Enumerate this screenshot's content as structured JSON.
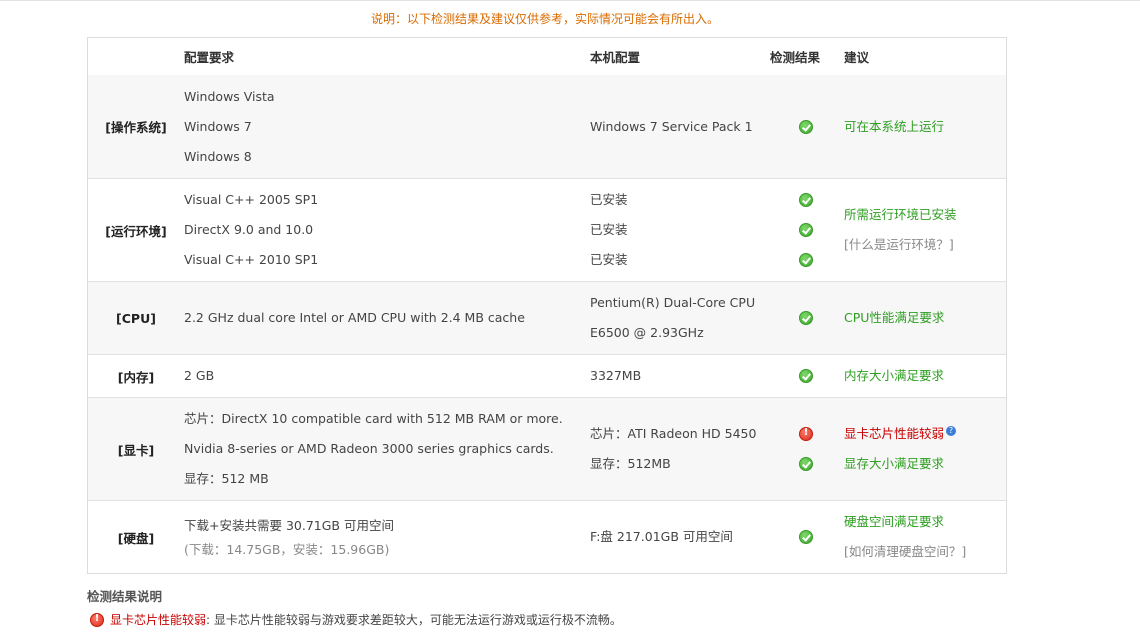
{
  "notice": "说明：以下检测结果及建议仅供参考，实际情况可能会有所出入。",
  "headers": {
    "requirement": "配置要求",
    "local": "本机配置",
    "result": "检测结果",
    "advice": "建议"
  },
  "rows": [
    {
      "label": "[操作系统]",
      "requirements": [
        "Windows Vista",
        "Windows 7",
        "Windows 8"
      ],
      "local": [
        "Windows 7 Service Pack 1"
      ],
      "results": [
        "ok"
      ],
      "advice": [
        {
          "text": "可在本系统上运行",
          "style": "green"
        }
      ]
    },
    {
      "label": "[运行环境]",
      "requirements": [
        "Visual C++ 2005 SP1",
        "DirectX 9.0 and 10.0",
        "Visual C++ 2010 SP1"
      ],
      "local": [
        "已安装",
        "已安装",
        "已安装"
      ],
      "results": [
        "ok",
        "ok",
        "ok"
      ],
      "advice": [
        {
          "text": "所需运行环境已安装",
          "style": "green"
        },
        {
          "text": "[什么是运行环境？]",
          "style": "gray"
        }
      ]
    },
    {
      "label": "[CPU]",
      "requirements": [
        "2.2 GHz dual core Intel or AMD CPU with 2.4 MB cache"
      ],
      "local": [
        "Pentium(R) Dual-Core CPU",
        "E6500 @ 2.93GHz"
      ],
      "results": [
        "ok"
      ],
      "advice": [
        {
          "text": "CPU性能满足要求",
          "style": "green"
        }
      ]
    },
    {
      "label": "[内存]",
      "requirements": [
        "2 GB"
      ],
      "local": [
        "3327MB"
      ],
      "results": [
        "ok"
      ],
      "advice": [
        {
          "text": "内存大小满足要求",
          "style": "green"
        }
      ]
    },
    {
      "label": "[显卡]",
      "requirements": [
        "芯片：DirectX 10 compatible card with 512 MB RAM or more.",
        "Nvidia 8-series or AMD Radeon 3000 series graphics cards.",
        "显存：512 MB"
      ],
      "local": [
        "芯片：ATI Radeon HD 5450",
        "显存：512MB"
      ],
      "results": [
        "bad",
        "ok"
      ],
      "advice": [
        {
          "text": "显卡芯片性能较弱",
          "style": "red",
          "help": "?"
        },
        {
          "text": "显存大小满足要求",
          "style": "green"
        }
      ]
    },
    {
      "label": "[硬盘]",
      "requirements": [
        "下载+安装共需要  30.71GB 可用空间"
      ],
      "requirements_sub": "(下载：14.75GB，安装：15.96GB)",
      "local": [
        "F:盘  217.01GB 可用空间"
      ],
      "results": [
        "ok"
      ],
      "advice": [
        {
          "text": "硬盘空间满足要求",
          "style": "green"
        },
        {
          "text": "[如何清理硬盘空间？]",
          "style": "gray"
        }
      ]
    }
  ],
  "footer": {
    "title": "检测结果说明",
    "item_label": "显卡芯片性能较弱",
    "item_text": ": 显卡芯片性能较弱与游戏要求差距较大，可能无法运行游戏或运行极不流畅。"
  },
  "colors": {
    "notice": "#d96b00",
    "ok": "#2e9e22",
    "bad": "#c80000",
    "advice_gray": "#888888"
  }
}
